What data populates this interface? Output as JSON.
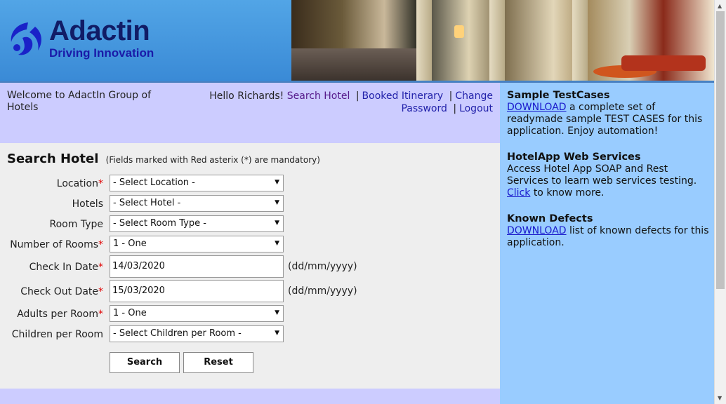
{
  "header": {
    "logo_title": "Adactin",
    "logo_subtitle": "Driving Innovation"
  },
  "welcome": {
    "text": "Welcome to AdactIn Group of Hotels"
  },
  "top_nav": {
    "greeting": "Hello Richards!",
    "search_hotel": "Search Hotel",
    "booked_itinerary": "Booked Itinerary",
    "change_password": "Change Password",
    "logout": "Logout",
    "separator": "|"
  },
  "form": {
    "title": "Search Hotel",
    "note": "(Fields marked with Red asterix (*) are mandatory)",
    "required_marker": "*",
    "date_format": "(dd/mm/yyyy)",
    "arrow": "▼",
    "fields": {
      "location": {
        "label": "Location",
        "value": "- Select Location -"
      },
      "hotels": {
        "label": "Hotels",
        "value": "- Select Hotel -"
      },
      "room_type": {
        "label": "Room Type",
        "value": "- Select Room Type -"
      },
      "number_of_rooms": {
        "label": "Number of Rooms",
        "value": "1 - One"
      },
      "check_in": {
        "label": "Check In Date",
        "value": "14/03/2020"
      },
      "check_out": {
        "label": "Check Out Date",
        "value": "15/03/2020"
      },
      "adults": {
        "label": "Adults per Room",
        "value": "1 - One"
      },
      "children": {
        "label": "Children per Room",
        "value": "- Select Children per Room -"
      }
    },
    "search_button": "Search",
    "reset_button": "Reset"
  },
  "right_panel": {
    "testcases": {
      "title": "Sample TestCases",
      "link": "DOWNLOAD",
      "text": "a complete set of readymade sample TEST CASES for this application. Enjoy automation!"
    },
    "webservices": {
      "title": "HotelApp Web Services",
      "text": "Access Hotel App SOAP and Rest Services to learn web services testing.",
      "link": "Click",
      "text_after": "to know more."
    },
    "defects": {
      "title": "Known Defects",
      "link": "DOWNLOAD",
      "text": "list of known defects for this application."
    }
  },
  "colors": {
    "header_blue": "#3a8ad6",
    "band_lavender": "#ccccff",
    "panel_blue": "#99ccff",
    "form_grey": "#eeeeee",
    "required_red": "#e00000",
    "link_blue": "#2222aa"
  },
  "icons": [
    "adactin-logo-icon",
    "dropdown-arrow-icon",
    "scroll-up-icon",
    "scroll-down-icon"
  ]
}
